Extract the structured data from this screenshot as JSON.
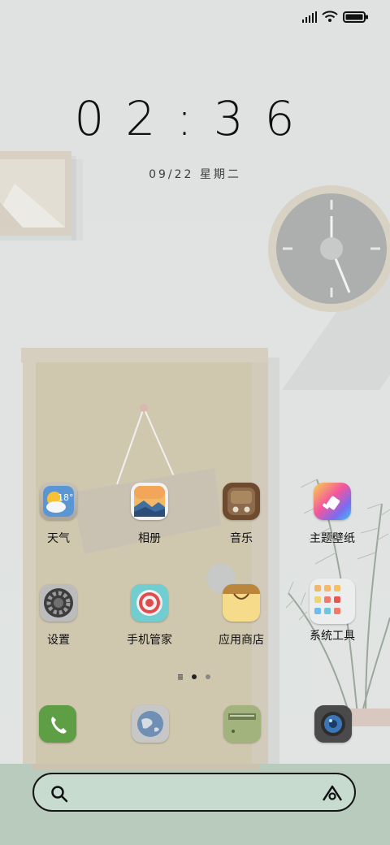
{
  "status_bar": {
    "signal_icon": "signal-icon",
    "wifi_icon": "wifi-icon",
    "battery_icon": "battery-icon"
  },
  "lock_clock": {
    "time": "02:36",
    "date": "09/22 星期二"
  },
  "apps": [
    {
      "label": "天气",
      "icon": "weather-icon",
      "temp": "18°"
    },
    {
      "label": "相册",
      "icon": "gallery-icon"
    },
    {
      "label": "音乐",
      "icon": "music-icon"
    },
    {
      "label": "主题壁纸",
      "icon": "theme-icon"
    },
    {
      "label": "设置",
      "icon": "gear-icon"
    },
    {
      "label": "手机管家",
      "icon": "target-icon"
    },
    {
      "label": "应用商店",
      "icon": "shopping-bag-icon"
    },
    {
      "label": "系统工具",
      "icon": "folder-icon"
    }
  ],
  "dock": [
    {
      "icon": "phone-icon"
    },
    {
      "icon": "globe-icon"
    },
    {
      "icon": "mailbox-icon"
    },
    {
      "icon": "camera-icon"
    }
  ],
  "search": {
    "search_icon": "search-icon",
    "assistant_icon": "assistant-icon"
  }
}
